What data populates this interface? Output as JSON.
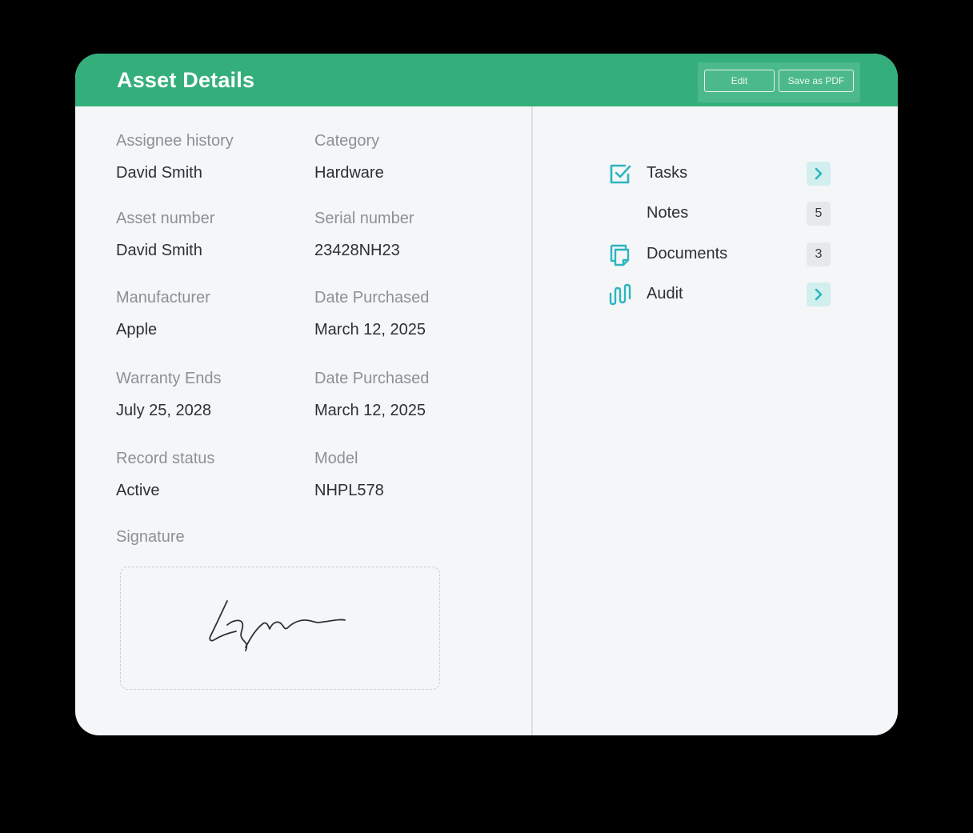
{
  "header": {
    "title": "Asset Details",
    "edit_label": "Edit",
    "pdf_label": "Save as PDF"
  },
  "fields": [
    {
      "label": "Assignee history",
      "value": "David Smith"
    },
    {
      "label": "Category",
      "value": "Hardware"
    },
    {
      "label": "Asset number",
      "value": "David Smith"
    },
    {
      "label": "Serial number",
      "value": "23428NH23"
    },
    {
      "label": "Manufacturer",
      "value": "Apple"
    },
    {
      "label": "Date Purchased",
      "value": "March 12, 2025"
    },
    {
      "label": "Warranty Ends",
      "value": "July 25, 2028"
    },
    {
      "label": "Date Purchased",
      "value": "March 12, 2025"
    },
    {
      "label": "Record status",
      "value": "Active"
    },
    {
      "label": "Model",
      "value": "NHPL578"
    }
  ],
  "signature": {
    "label": "Signature"
  },
  "sidebar": {
    "items": [
      {
        "label": "Tasks",
        "icon": "checkbox-icon",
        "action": "chevron-right-icon"
      },
      {
        "label": "Notes",
        "icon": "",
        "count": "5"
      },
      {
        "label": "Documents",
        "icon": "documents-icon",
        "count": "3"
      },
      {
        "label": "Audit",
        "icon": "audit-wave-icon",
        "action": "chevron-right-icon"
      }
    ]
  },
  "colors": {
    "header_bg": "#34af7b",
    "accent_teal": "#2bb5bf",
    "chevron_bg": "#d2efef",
    "badge_bg": "#e6e8ea",
    "card_bg": "#f4f6f8"
  }
}
